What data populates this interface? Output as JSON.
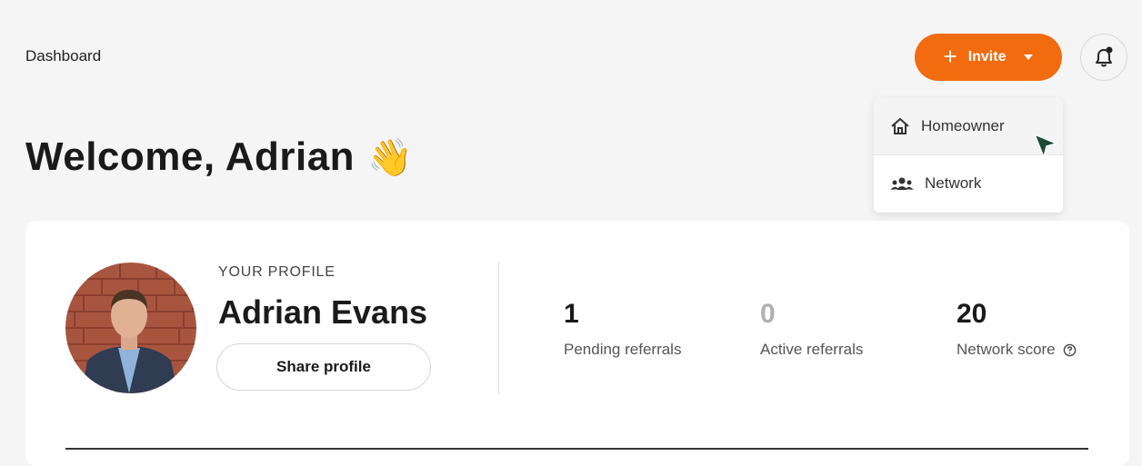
{
  "header": {
    "breadcrumb": "Dashboard",
    "invite_label": "Invite"
  },
  "dropdown": {
    "items": [
      {
        "label": "Homeowner",
        "icon": "home-icon"
      },
      {
        "label": "Network",
        "icon": "users-icon"
      }
    ]
  },
  "welcome": {
    "text": "Welcome, Adrian",
    "emoji": "👋"
  },
  "profile": {
    "section_label": "YOUR PROFILE",
    "name": "Adrian Evans",
    "share_label": "Share profile"
  },
  "stats": [
    {
      "value": "1",
      "label": "Pending referrals"
    },
    {
      "value": "0",
      "label": "Active referrals"
    },
    {
      "value": "20",
      "label": "Network score"
    }
  ],
  "colors": {
    "accent": "#f26b0f",
    "cursor": "#1d4a36"
  }
}
